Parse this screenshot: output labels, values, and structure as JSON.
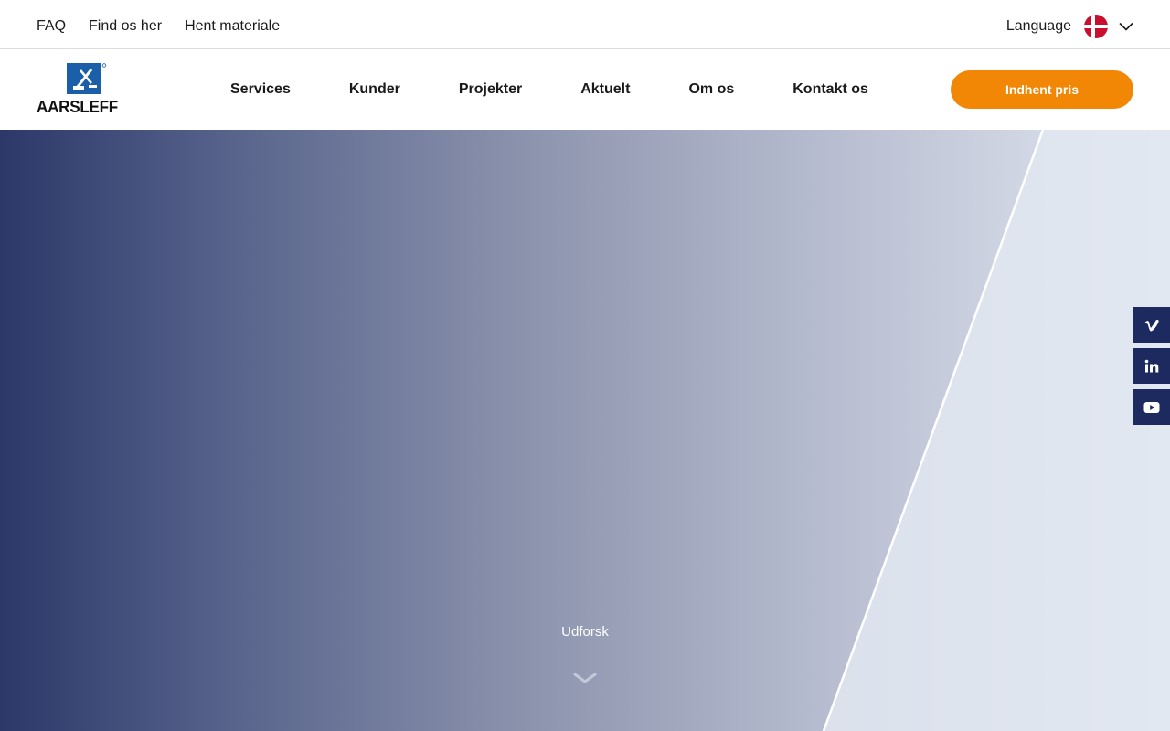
{
  "topbar": {
    "links": [
      {
        "label": "FAQ"
      },
      {
        "label": "Find os her"
      },
      {
        "label": "Hent materiale"
      }
    ],
    "language_label": "Language",
    "language_flag_icon": "denmark-flag-icon"
  },
  "header": {
    "logo_text": "AARSLEFF",
    "nav": [
      {
        "label": "Services"
      },
      {
        "label": "Kunder"
      },
      {
        "label": "Projekter"
      },
      {
        "label": "Aktuelt"
      },
      {
        "label": "Om os"
      },
      {
        "label": "Kontakt os"
      }
    ],
    "cta_label": "Indhent pris"
  },
  "hero": {
    "explore_label": "Udforsk"
  },
  "social": [
    {
      "icon": "vimeo-icon"
    },
    {
      "icon": "linkedin-icon"
    },
    {
      "icon": "youtube-icon"
    }
  ],
  "colors": {
    "accent": "#f28705",
    "brand_navy": "#1d2a5f",
    "logo_blue": "#1a5fa8"
  }
}
